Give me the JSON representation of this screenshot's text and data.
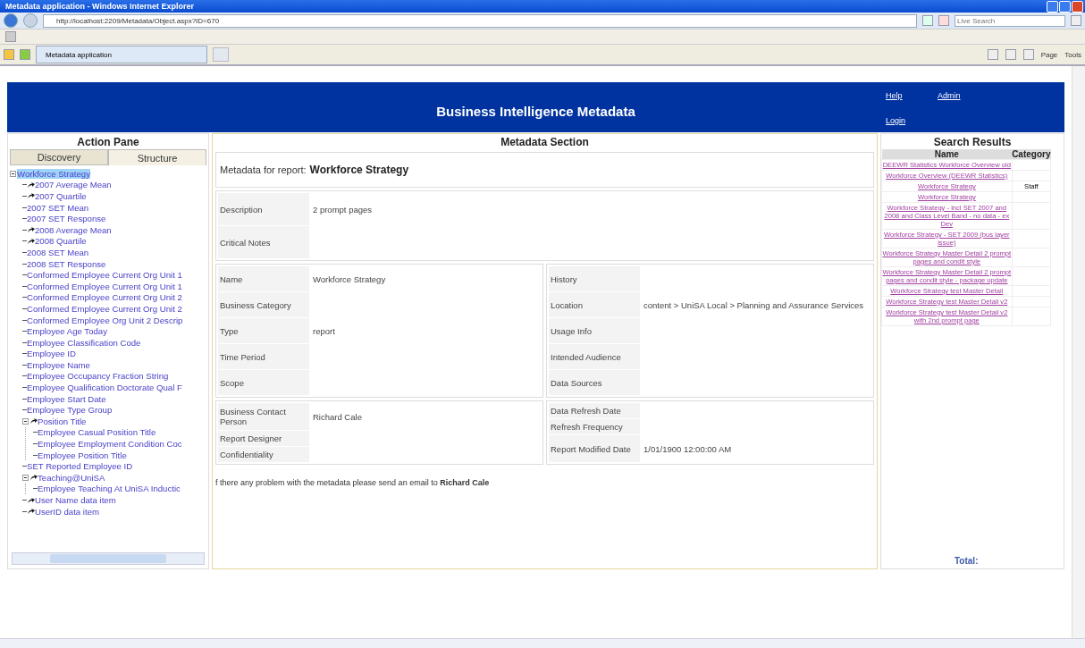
{
  "browser": {
    "title": "Metadata application - Windows Internet Explorer",
    "address": "http://localhost:2209/Metadata/Object.aspx?ID=670",
    "search_placeholder": "Live Search",
    "tab": "Metadata application",
    "commands": [
      "Page",
      "Tools"
    ]
  },
  "header": {
    "title": "Business Intelligence Metadata",
    "links": [
      "Help",
      "Admin",
      "Login"
    ]
  },
  "action_pane": {
    "title": "Action Pane",
    "tabs": [
      {
        "label": "Discovery",
        "selected": false
      },
      {
        "label": "Structure",
        "selected": true
      }
    ],
    "tree": [
      {
        "label": "Workforce Strategy",
        "kind": "root",
        "selected": true,
        "expanded": true,
        "children": [
          {
            "label": "2007 Average Mean",
            "kind": "calc",
            "selected": false
          },
          {
            "label": "2007 Quartile",
            "kind": "calc",
            "selected": false
          },
          {
            "label": "2007 SET Mean",
            "kind": "field",
            "selected": false
          },
          {
            "label": "2007 SET Response",
            "kind": "field",
            "selected": false
          },
          {
            "label": "2008 Average Mean",
            "kind": "calc",
            "selected": false
          },
          {
            "label": "2008 Quartile",
            "kind": "calc",
            "selected": false
          },
          {
            "label": "2008 SET Mean",
            "kind": "field",
            "selected": false
          },
          {
            "label": "2008 SET Response",
            "kind": "field",
            "selected": false
          },
          {
            "label": "Conformed Employee Current Org Unit 1",
            "kind": "field",
            "selected": false
          },
          {
            "label": "Conformed Employee Current Org Unit 1",
            "kind": "field",
            "selected": false
          },
          {
            "label": "Conformed Employee Current Org Unit 2",
            "kind": "field",
            "selected": false
          },
          {
            "label": "Conformed Employee Current Org Unit 2",
            "kind": "field",
            "selected": false
          },
          {
            "label": "Conformed Employee Org Unit 2 Descrip",
            "kind": "field",
            "selected": false
          },
          {
            "label": "Employee Age Today",
            "kind": "field",
            "selected": false
          },
          {
            "label": "Employee Classification Code",
            "kind": "field",
            "selected": false
          },
          {
            "label": "Employee ID",
            "kind": "field",
            "selected": false
          },
          {
            "label": "Employee Name",
            "kind": "field",
            "selected": false
          },
          {
            "label": "Employee Occupancy Fraction String",
            "kind": "field",
            "selected": false
          },
          {
            "label": "Employee Qualification Doctorate Qual F",
            "kind": "field",
            "selected": false
          },
          {
            "label": "Employee Start Date",
            "kind": "field",
            "selected": false
          },
          {
            "label": "Employee Type Group",
            "kind": "field",
            "selected": false
          },
          {
            "label": "Position Title",
            "kind": "calc",
            "selected": false,
            "expanded": true,
            "children": [
              {
                "label": "Employee Casual Position Title",
                "kind": "field",
                "selected": false
              },
              {
                "label": "Employee Employment Condition Coc",
                "kind": "field",
                "selected": false
              },
              {
                "label": "Employee Position Title",
                "kind": "field",
                "selected": false
              }
            ]
          },
          {
            "label": "SET Reported Employee ID",
            "kind": "field",
            "selected": false
          },
          {
            "label": "Teaching@UniSA",
            "kind": "calc",
            "selected": false,
            "expanded": true,
            "children": [
              {
                "label": "Employee Teaching At UniSA Inductic",
                "kind": "field",
                "selected": false
              }
            ]
          },
          {
            "label": "User Name data item",
            "kind": "calc",
            "selected": false
          },
          {
            "label": "UserID data item",
            "kind": "calc",
            "selected": false
          }
        ]
      }
    ]
  },
  "metadata": {
    "title": "Metadata Section",
    "report_label": "Metadata for report:",
    "report_name": "Workforce Strategy",
    "notes": [
      {
        "label": "Description",
        "value": "2 prompt pages"
      },
      {
        "label": "Critical Notes"
      }
    ],
    "details_left": [
      {
        "label": "Name",
        "value": "Workforce Strategy"
      },
      {
        "label": "Business Category"
      },
      {
        "label": "Type",
        "value": "report"
      },
      {
        "label": "Time Period"
      },
      {
        "label": "Scope"
      }
    ],
    "details_right": [
      {
        "label": "History"
      },
      {
        "label": "Location",
        "value": "content > UniSA Local > Planning and Assurance Services"
      },
      {
        "label": "Usage Info"
      },
      {
        "label": "Intended Audience"
      },
      {
        "label": "Data Sources"
      }
    ],
    "contact_left": [
      {
        "label": "Business Contact Person",
        "value": "Richard Cale"
      },
      {
        "label": "Report Designer"
      },
      {
        "label": "Confidentiality"
      }
    ],
    "contact_right": [
      {
        "label": "Data Refresh Date"
      },
      {
        "label": "Refresh Frequency"
      },
      {
        "label": "Report Modified Date",
        "value": "1/01/1900 12:00:00 AM"
      }
    ],
    "footer": "f there any problem with the metadata please send an email to **Richard Cale**"
  },
  "search_results": {
    "title": "Search Results",
    "columns": [
      "Name",
      "Category"
    ],
    "rows": [
      {
        "name": "DEEWR Statistics  Workforce Overview old"
      },
      {
        "name": "Workforce Overview (DEEWR Statistics)"
      },
      {
        "name": "Workforce Strategy",
        "category": "Staff"
      },
      {
        "name": "Workforce Strategy"
      },
      {
        "name": "Workforce Strategy - incl SET 2007 and 2008 and Class Level Band - no data - ex Dev"
      },
      {
        "name": "Workforce Strategy - SET 2009 (bus layer issue)"
      },
      {
        "name": "Workforce Strategy Master Detail 2 prompt pages and condit style"
      },
      {
        "name": "Workforce Strategy Master Detail 2 prompt pages and condit style - package update"
      },
      {
        "name": "Workforce Strategy test Master Detail"
      },
      {
        "name": "Workforce Strategy test Master Detail v2"
      },
      {
        "name": "Workforce Strategy test Master Detail v2 with 2nd prompt page"
      }
    ],
    "total_label": "Total:"
  }
}
